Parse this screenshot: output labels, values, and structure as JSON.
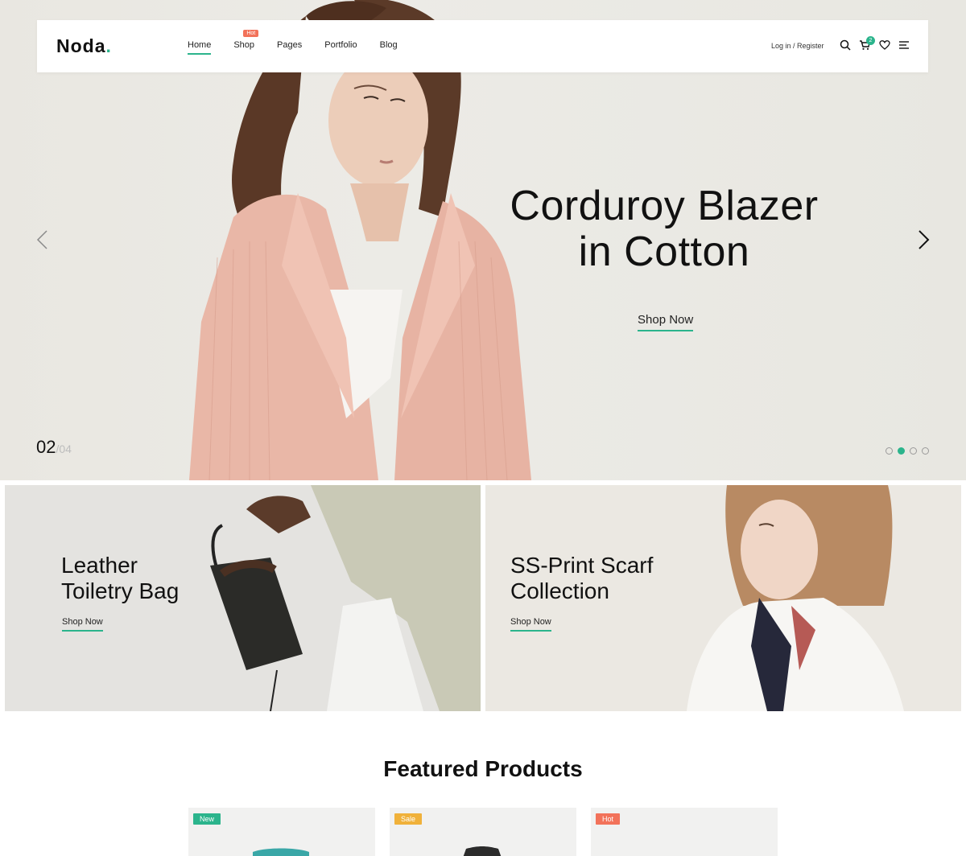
{
  "header": {
    "logo": "Noda",
    "logo_dot": ".",
    "nav": [
      {
        "label": "Home",
        "active": true
      },
      {
        "label": "Shop",
        "badge": "Hot"
      },
      {
        "label": "Pages"
      },
      {
        "label": "Portfolio"
      },
      {
        "label": "Blog"
      }
    ],
    "login": "Log in / Register",
    "cart_count": "2",
    "icons": [
      "search-icon",
      "cart-icon",
      "heart-icon",
      "menu-icon"
    ]
  },
  "hero": {
    "title_line1": "Corduroy Blazer",
    "title_line2": "in Cotton",
    "cta": "Shop Now",
    "current_slide": "02",
    "total_slides": "/04",
    "dots_count": 4,
    "active_dot": 2
  },
  "banners": [
    {
      "title_line1": "Leather",
      "title_line2": "Toiletry Bag",
      "cta": "Shop Now"
    },
    {
      "title_line1": "SS-Print Scarf",
      "title_line2": "Collection",
      "cta": "Shop Now"
    }
  ],
  "featured": {
    "title": "Featured Products",
    "products": [
      {
        "badge": "New"
      },
      {
        "badge": "Sale"
      },
      {
        "badge": "Hot"
      }
    ]
  },
  "colors": {
    "accent": "#2bb48c",
    "hot": "#f2725a",
    "sale": "#f0b13a",
    "new": "#2bb48c"
  }
}
